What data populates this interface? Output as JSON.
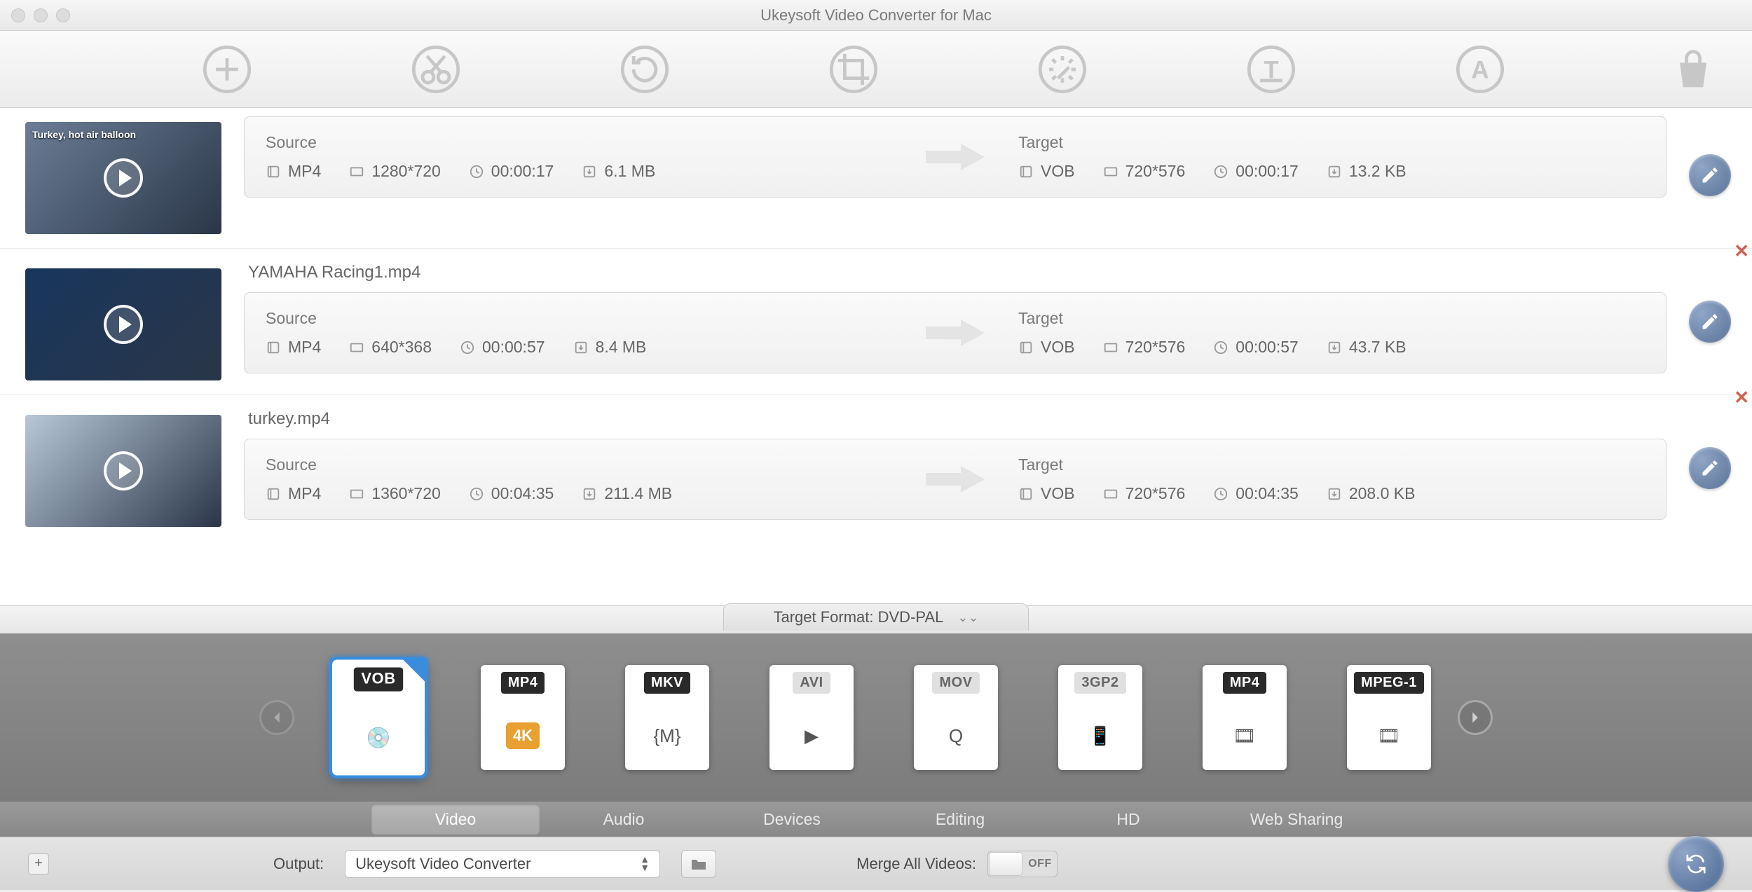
{
  "window": {
    "title": "Ukeysoft Video Converter for Mac"
  },
  "toolbar_icons": [
    "add",
    "trim",
    "rotate",
    "crop",
    "effect",
    "watermark",
    "subtitle",
    "shop"
  ],
  "rows": [
    {
      "filename": "",
      "source": {
        "label": "Source",
        "format": "MP4",
        "resolution": "1280*720",
        "duration": "00:00:17",
        "size": "6.1 MB"
      },
      "target": {
        "label": "Target",
        "format": "VOB",
        "resolution": "720*576",
        "duration": "00:00:17",
        "size": "13.2 KB"
      },
      "show_close": false,
      "thumb_tint": "#6b7d95",
      "overlay_text": "Turkey, hot air balloon"
    },
    {
      "filename": "YAMAHA Racing1.mp4",
      "source": {
        "label": "Source",
        "format": "MP4",
        "resolution": "640*368",
        "duration": "00:00:57",
        "size": "8.4 MB"
      },
      "target": {
        "label": "Target",
        "format": "VOB",
        "resolution": "720*576",
        "duration": "00:00:57",
        "size": "43.7 KB"
      },
      "show_close": true,
      "thumb_tint": "#18365d",
      "overlay_text": ""
    },
    {
      "filename": "turkey.mp4",
      "source": {
        "label": "Source",
        "format": "MP4",
        "resolution": "1360*720",
        "duration": "00:04:35",
        "size": "211.4 MB"
      },
      "target": {
        "label": "Target",
        "format": "VOB",
        "resolution": "720*576",
        "duration": "00:04:35",
        "size": "208.0 KB"
      },
      "show_close": true,
      "thumb_tint": "#b8c8d8",
      "overlay_text": ""
    }
  ],
  "target_format_tab": "Target Format: DVD-PAL",
  "formats": [
    {
      "label": "VOB",
      "selected": true,
      "style": "blk",
      "icon": "💿"
    },
    {
      "label": "MP4",
      "selected": false,
      "style": "blk",
      "icon": "4K",
      "sub": "gold"
    },
    {
      "label": "MKV",
      "selected": false,
      "style": "blk",
      "icon": "{M}"
    },
    {
      "label": "AVI",
      "selected": false,
      "style": "gry",
      "icon": "▶"
    },
    {
      "label": "MOV",
      "selected": false,
      "style": "gry",
      "icon": "Q"
    },
    {
      "label": "3GP2",
      "selected": false,
      "style": "gry",
      "icon": "📱"
    },
    {
      "label": "MP4",
      "selected": false,
      "style": "blk",
      "icon": "🎞"
    },
    {
      "label": "MPEG-1",
      "selected": false,
      "style": "blk",
      "icon": "🎞"
    }
  ],
  "categories": [
    {
      "label": "Video",
      "active": true
    },
    {
      "label": "Audio",
      "active": false
    },
    {
      "label": "Devices",
      "active": false
    },
    {
      "label": "Editing",
      "active": false
    },
    {
      "label": "HD",
      "active": false
    },
    {
      "label": "Web Sharing",
      "active": false
    }
  ],
  "bottom": {
    "output_label": "Output:",
    "output_value": "Ukeysoft Video Converter",
    "merge_label": "Merge All Videos:",
    "merge_state": "OFF"
  }
}
